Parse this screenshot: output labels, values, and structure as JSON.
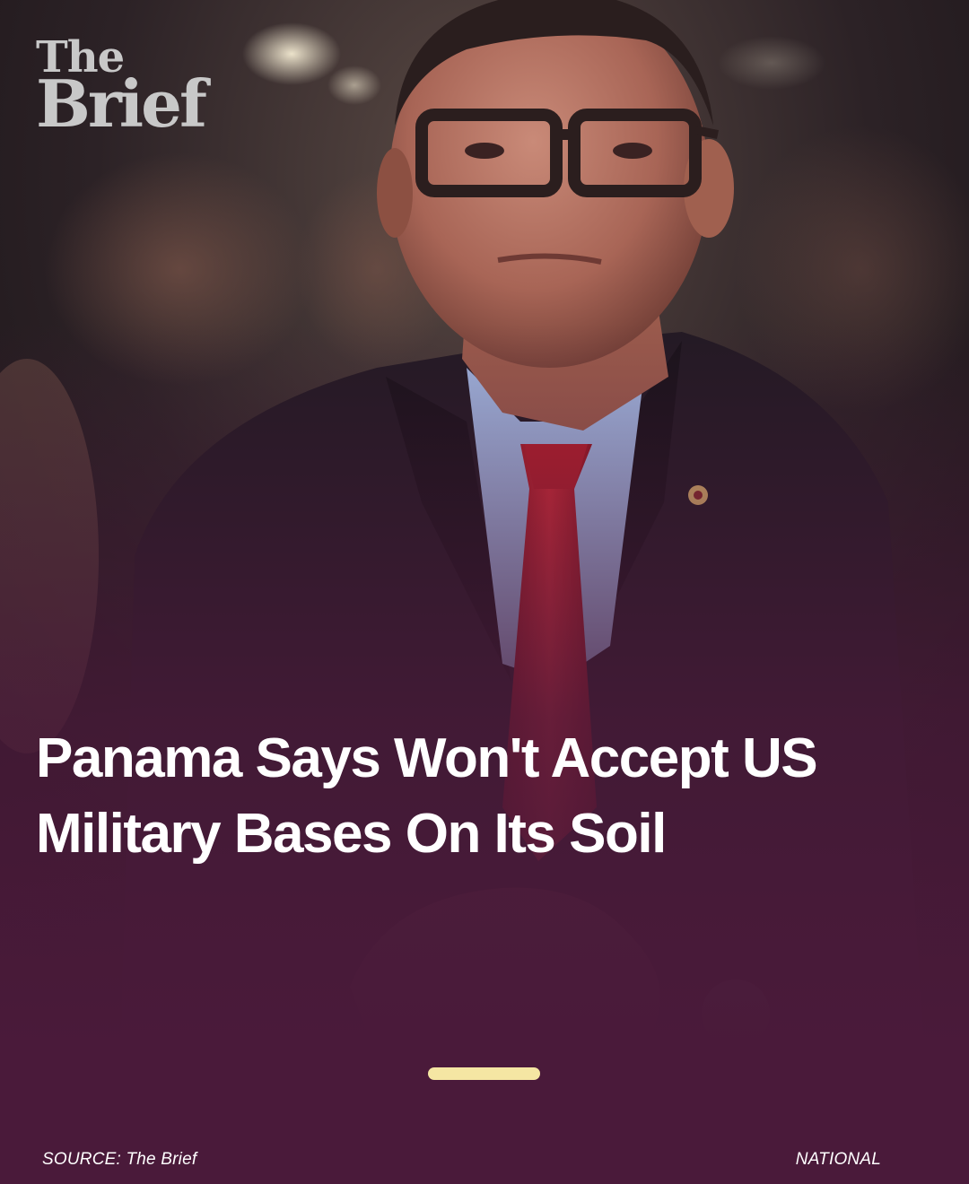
{
  "brand": {
    "line1": "The",
    "line2": "Brief",
    "color": "#c8c8c8"
  },
  "headline": {
    "text": "Panama Says Won't Accept US Military Bases On Its Soil"
  },
  "pager": {
    "color": "#f5e6a3"
  },
  "footer": {
    "source": "SOURCE: The Brief",
    "category": "NATIONAL"
  },
  "colors": {
    "background": "#4a1a3a",
    "headline": "#ffffff"
  }
}
